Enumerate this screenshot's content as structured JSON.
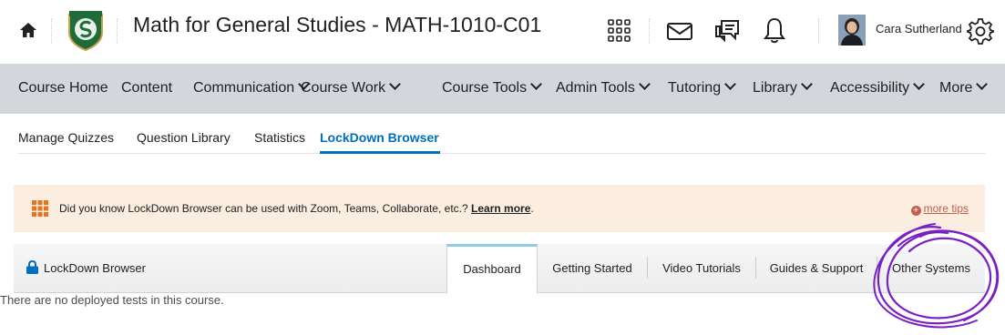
{
  "header": {
    "course_title": "Math for General Studies - MATH-1010-C01",
    "user_name": "Cara Sutherland",
    "icons": [
      "home-icon",
      "school-logo",
      "apps-grid-icon",
      "mail-icon",
      "chat-icon",
      "bell-icon",
      "avatar",
      "gear-icon"
    ]
  },
  "nav": {
    "items": [
      {
        "label": "Course Home"
      },
      {
        "label": "Content"
      },
      {
        "label": "Communication"
      },
      {
        "label": "Course Work"
      },
      {
        "label": "Course Tools"
      },
      {
        "label": "Admin Tools"
      },
      {
        "label": "Tutoring"
      },
      {
        "label": "Library"
      },
      {
        "label": "Accessibility"
      },
      {
        "label": "More"
      }
    ]
  },
  "subtabs": {
    "items": [
      {
        "label": "Manage Quizzes"
      },
      {
        "label": "Question Library"
      },
      {
        "label": "Statistics"
      },
      {
        "label": "LockDown Browser",
        "active": true
      }
    ]
  },
  "tip": {
    "text": "Did you know LockDown Browser can be used with Zoom, Teams, Collaborate, etc.?",
    "link": "Learn more",
    "suffix": ".",
    "more_tips": "more tips"
  },
  "panel": {
    "title": "LockDown Browser",
    "tabs": [
      {
        "label": "Dashboard",
        "active": true
      },
      {
        "label": "Getting Started"
      },
      {
        "label": "Video Tutorials"
      },
      {
        "label": "Guides & Support"
      },
      {
        "label": "Other Systems"
      }
    ],
    "empty_message": "There are no deployed tests in this course."
  },
  "colors": {
    "accent_blue": "#006fbf",
    "nav_bg": "#d3d6da",
    "tip_bg": "#fbeee0",
    "tip_icon": "#e8731e",
    "annotation_purple": "#7a1ec6"
  }
}
